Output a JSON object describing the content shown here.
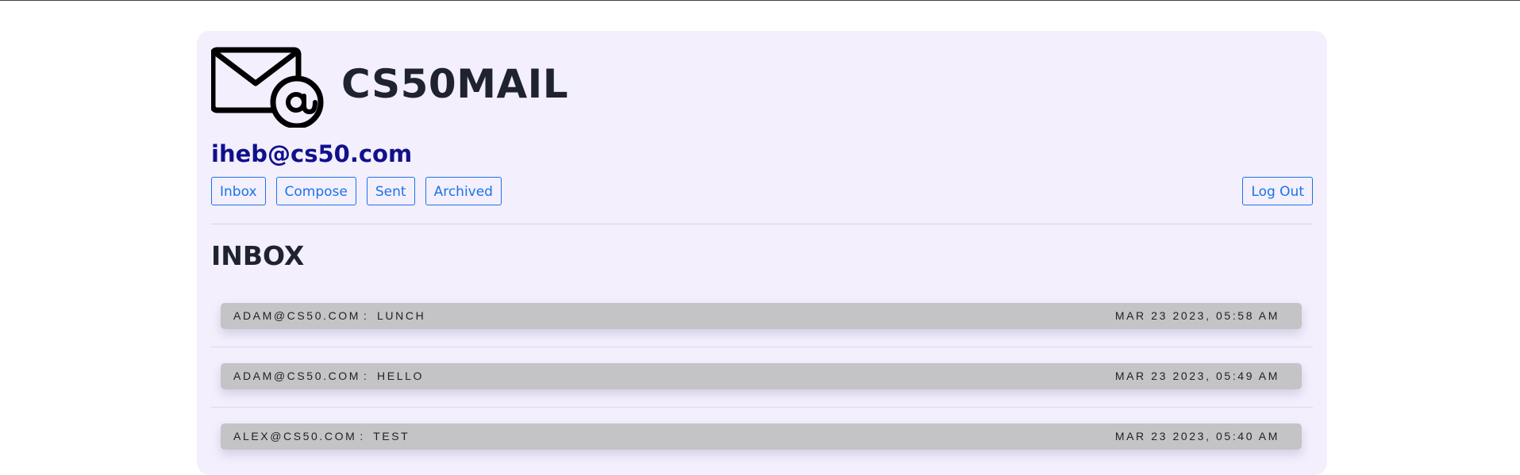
{
  "app": {
    "title": "CS50MAIL",
    "user_email": "iheb@cs50.com"
  },
  "nav": {
    "inbox": "Inbox",
    "compose": "Compose",
    "sent": "Sent",
    "archived": "Archived",
    "logout": "Log Out"
  },
  "mailbox": {
    "title": "INBOX"
  },
  "emails": [
    {
      "sender": "ADAM@CS50.COM",
      "separator": ":",
      "subject": "LUNCH",
      "timestamp": "MAR 23 2023, 05:58 AM"
    },
    {
      "sender": "ADAM@CS50.COM",
      "separator": ":",
      "subject": "HELLO",
      "timestamp": "MAR 23 2023, 05:49 AM"
    },
    {
      "sender": "ALEX@CS50.COM",
      "separator": ":",
      "subject": "TEST",
      "timestamp": "MAR 23 2023, 05:40 AM"
    }
  ],
  "colors": {
    "panel_bg": "#f3effd",
    "accent": "#1a73e8",
    "user_email": "#10108c",
    "row_bg": "#c4c3c6"
  },
  "icons": {
    "logo": "mail-at-icon"
  }
}
